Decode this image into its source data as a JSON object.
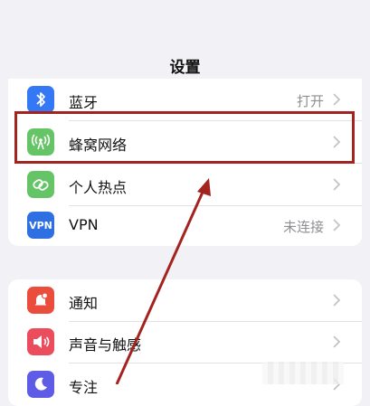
{
  "header": {
    "title": "设置"
  },
  "group1": [
    {
      "label": "蓝牙",
      "value": "打开",
      "icon": "bluetooth-icon",
      "color": "#3478f6"
    },
    {
      "label": "蜂窝网络",
      "value": "",
      "icon": "cellular-antenna-icon",
      "color": "#65c466"
    },
    {
      "label": "个人热点",
      "value": "",
      "icon": "hotspot-link-icon",
      "color": "#65c466"
    },
    {
      "label": "VPN",
      "value": "未连接",
      "icon": "vpn-icon",
      "icon_text": "VPN",
      "color": "#2f6fe4"
    }
  ],
  "group2": [
    {
      "label": "通知",
      "icon": "notification-bell-icon",
      "color": "#eb4d3d"
    },
    {
      "label": "声音与触感",
      "icon": "speaker-icon",
      "color": "#eb4d5c"
    },
    {
      "label": "专注",
      "icon": "moon-icon",
      "color": "#5e5ce6"
    }
  ],
  "annotation": {
    "color": "#a3231f"
  }
}
